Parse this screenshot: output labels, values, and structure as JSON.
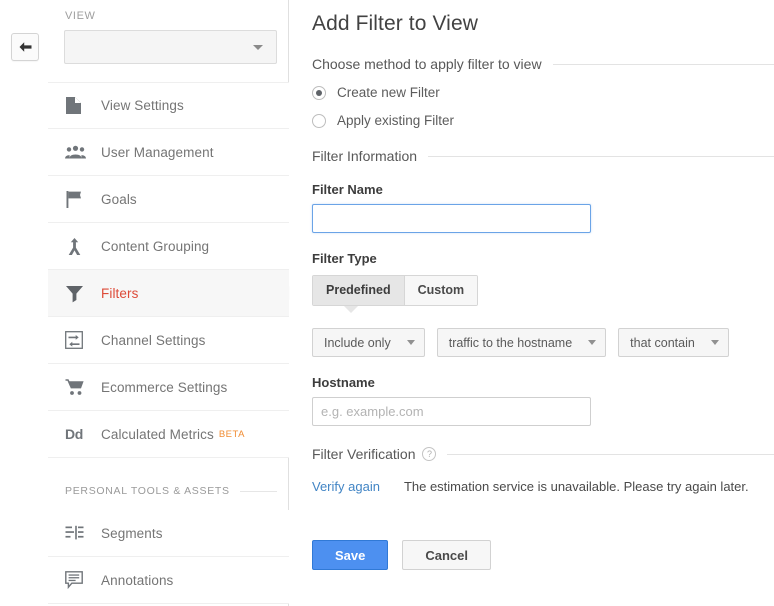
{
  "back_button": {
    "icon": "back-arrow-icon"
  },
  "sidebar": {
    "view_label": "VIEW",
    "view_select_value": "",
    "items": [
      {
        "label": "View Settings",
        "icon": "document-icon",
        "active": false
      },
      {
        "label": "User Management",
        "icon": "people-icon",
        "active": false
      },
      {
        "label": "Goals",
        "icon": "flag-icon",
        "active": false
      },
      {
        "label": "Content Grouping",
        "icon": "merge-arrows-icon",
        "active": false
      },
      {
        "label": "Filters",
        "icon": "funnel-icon",
        "active": true
      },
      {
        "label": "Channel Settings",
        "icon": "channel-box-icon",
        "active": false
      },
      {
        "label": "Ecommerce Settings",
        "icon": "shopping-cart-icon",
        "active": false
      },
      {
        "label": "Calculated Metrics",
        "icon": "dd-text-icon",
        "active": false,
        "badge": "BETA"
      }
    ],
    "personal_section": {
      "title": "PERSONAL TOOLS & ASSETS",
      "items": [
        {
          "label": "Segments",
          "icon": "segments-icon"
        },
        {
          "label": "Annotations",
          "icon": "annotations-icon"
        }
      ]
    }
  },
  "main": {
    "title": "Add Filter to View",
    "method_section": {
      "heading": "Choose method to apply filter to view",
      "options": [
        {
          "label": "Create new Filter",
          "selected": true
        },
        {
          "label": "Apply existing Filter",
          "selected": false
        }
      ]
    },
    "filter_information": {
      "heading": "Filter Information",
      "name_label": "Filter Name",
      "name_value": "",
      "name_placeholder": "",
      "type_label": "Filter Type",
      "tabs": [
        {
          "label": "Predefined",
          "selected": true
        },
        {
          "label": "Custom",
          "selected": false
        }
      ],
      "dropdowns": [
        {
          "value": "Include only"
        },
        {
          "value": "traffic to the hostname"
        },
        {
          "value": "that contain"
        }
      ],
      "hostname_label": "Hostname",
      "hostname_value": "",
      "hostname_placeholder": "e.g. example.com"
    },
    "filter_verification": {
      "heading": "Filter Verification",
      "help_glyph": "?",
      "verify_link": "Verify again",
      "message": "The estimation service is unavailable. Please try again later."
    },
    "actions": {
      "save_label": "Save",
      "cancel_label": "Cancel"
    }
  },
  "colors": {
    "accent_red": "#dd4b39",
    "link_blue": "#4285c5",
    "primary_button": "#4d90f0",
    "beta_orange": "#f08c33"
  }
}
